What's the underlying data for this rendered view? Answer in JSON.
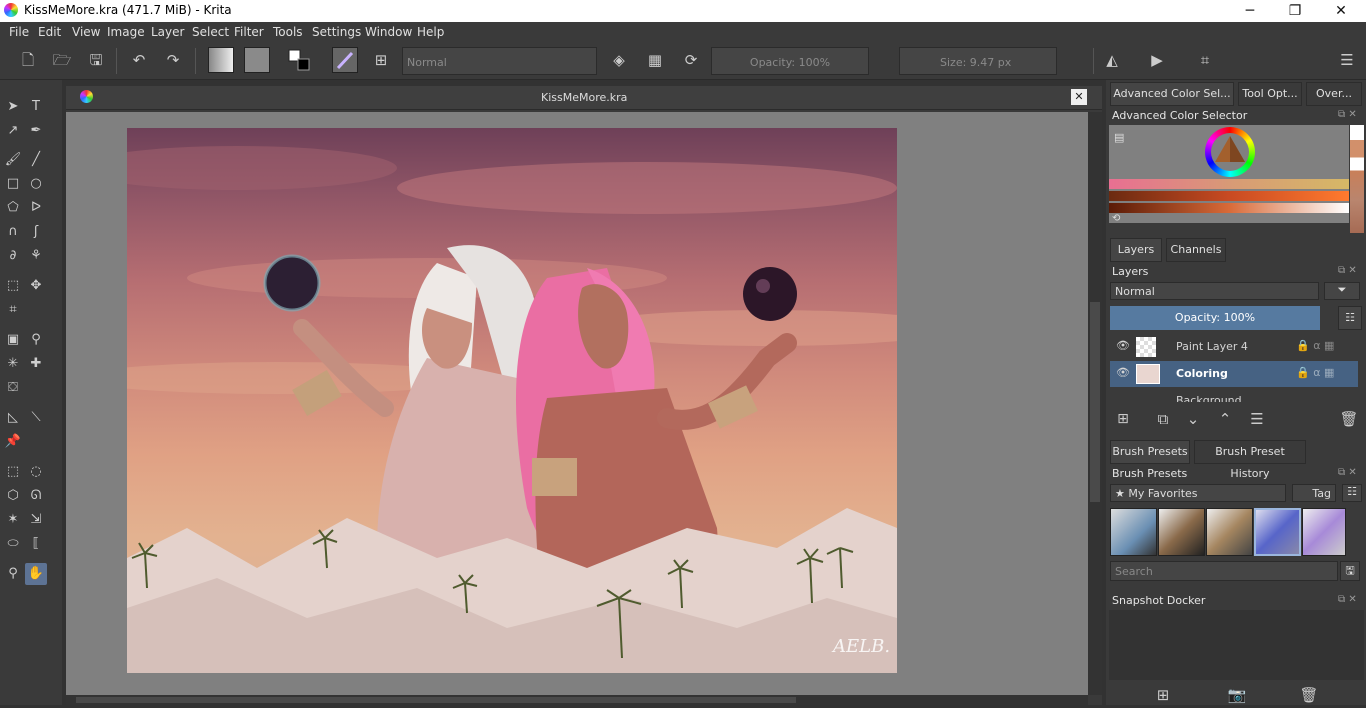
{
  "window": {
    "title": "KissMeMore.kra (471.7 MiB)  - Krita",
    "minimize_glyph": "─",
    "restore_glyph": "❐",
    "close_glyph": "✕"
  },
  "menu": [
    "File",
    "Edit",
    "View",
    "Image",
    "Layer",
    "Select",
    "Filter",
    "Tools",
    "Settings",
    "Window",
    "Help"
  ],
  "toolbar": {
    "blend_mode": "Normal",
    "opacity": "Opacity: 100%",
    "size": "Size: 9.47 px"
  },
  "document": {
    "tab_title": "KissMeMore.kra",
    "signature": "AELB."
  },
  "dockers": {
    "top_tabs": [
      "Advanced Color Sel...",
      "Tool Opt...",
      "Over..."
    ],
    "color_selector_title": "Advanced Color Selector",
    "layer_tabs": [
      "Layers",
      "Channels"
    ],
    "layers_title": "Layers",
    "layer_blend": "Normal",
    "layer_opacity": "Opacity:  100%",
    "layers": [
      {
        "name": "Paint Layer 4",
        "selected": false
      },
      {
        "name": "Coloring",
        "selected": true
      },
      {
        "name": "Background",
        "selected": false
      }
    ],
    "brush_tabs": [
      "Brush Presets",
      "Brush Preset History"
    ],
    "brush_title": "Brush Presets",
    "brush_filter": "★ My Favorites",
    "brush_tag": "Tag",
    "brush_search_placeholder": "Search",
    "snapshot_title": "Snapshot Docker"
  },
  "colors": {
    "accent": "#466283",
    "panel": "#3a3a3a",
    "canvas_bg": "#808080"
  }
}
